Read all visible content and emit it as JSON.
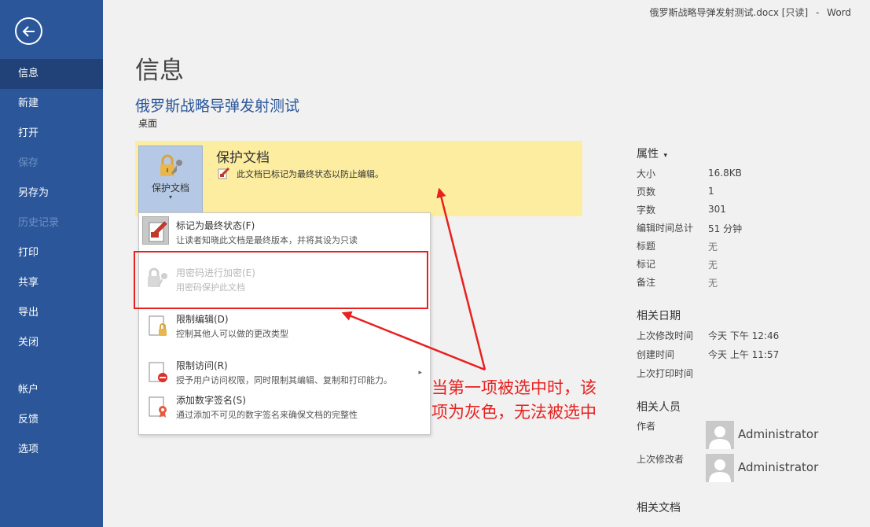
{
  "titlebar": {
    "doc_file": "俄罗斯战略导弹发射测试.docx [只读]",
    "separator": "-",
    "app": "Word"
  },
  "sidebar": {
    "items": [
      {
        "label": "信息",
        "active": true
      },
      {
        "label": "新建"
      },
      {
        "label": "打开"
      },
      {
        "label": "保存",
        "disabled": true
      },
      {
        "label": "另存为"
      },
      {
        "label": "历史记录",
        "disabled": true
      },
      {
        "label": "打印"
      },
      {
        "label": "共享"
      },
      {
        "label": "导出"
      },
      {
        "label": "关闭"
      },
      {
        "label": "帐户"
      },
      {
        "label": "反馈"
      },
      {
        "label": "选项"
      }
    ]
  },
  "main": {
    "title": "信息",
    "doc_name": "俄罗斯战略导弹发射测试",
    "doc_location": "桌面",
    "protect": {
      "button_label": "保护文档",
      "caret": "▾",
      "heading": "保护文档",
      "description": "此文档已标记为最终状态以防止编辑。"
    },
    "menu": [
      {
        "title": "标记为最终状态(F)",
        "desc": "让读者知晓此文档是最终版本，并将其设为只读"
      },
      {
        "title": "用密码进行加密(E)",
        "desc": "用密码保护此文档",
        "disabled": true
      },
      {
        "title": "限制编辑(D)",
        "desc": "控制其他人可以做的更改类型"
      },
      {
        "title": "限制访问(R)",
        "desc": "授予用户访问权限，同时限制其编辑、复制和打印能力。",
        "arrow": "▸"
      },
      {
        "title": "添加数字签名(S)",
        "desc": "通过添加不可见的数字签名来确保文档的完整性"
      }
    ]
  },
  "annotation": {
    "line1": "当第一项被选中时，该",
    "line2": "项为灰色，无法被选中"
  },
  "properties": {
    "heading": "属性",
    "caret": "▾",
    "rows": [
      {
        "label": "大小",
        "value": "16.8KB"
      },
      {
        "label": "页数",
        "value": "1"
      },
      {
        "label": "字数",
        "value": "301"
      },
      {
        "label": "编辑时间总计",
        "value": "51 分钟"
      },
      {
        "label": "标题",
        "value": "无",
        "muted": true
      },
      {
        "label": "标记",
        "value": "无",
        "muted": true
      },
      {
        "label": "备注",
        "value": "无",
        "muted": true
      }
    ],
    "dates_heading": "相关日期",
    "dates": [
      {
        "label": "上次修改时间",
        "value": "今天 下午 12:46"
      },
      {
        "label": "创建时间",
        "value": "今天 上午 11:57"
      },
      {
        "label": "上次打印时间",
        "value": ""
      }
    ],
    "people_heading": "相关人员",
    "people": [
      {
        "label": "作者",
        "name": "Administrator"
      },
      {
        "label": "上次修改者",
        "name": "Administrator"
      }
    ],
    "docs_heading": "相关文档"
  },
  "colors": {
    "sidebar": "#2b579a",
    "sidebar_active": "#204278",
    "panel_yellow": "#fdeda0",
    "annotation_red": "#e8201e"
  }
}
